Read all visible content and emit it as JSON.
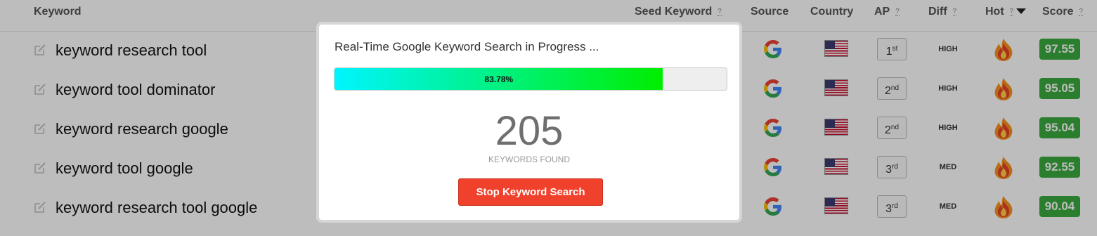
{
  "table": {
    "columns": {
      "keyword": "Keyword",
      "seed_keyword": "Seed Keyword",
      "source": "Source",
      "country": "Country",
      "ap": "AP",
      "diff": "Diff",
      "hot": "Hot",
      "score": "Score",
      "help": "?"
    },
    "rows": [
      {
        "keyword": "keyword research tool",
        "ap_num": "1",
        "ap_suffix": "st",
        "diff": "HIGH",
        "score": "97.55"
      },
      {
        "keyword": "keyword tool dominator",
        "ap_num": "2",
        "ap_suffix": "nd",
        "diff": "HIGH",
        "score": "95.05"
      },
      {
        "keyword": "keyword research google",
        "ap_num": "2",
        "ap_suffix": "nd",
        "diff": "HIGH",
        "score": "95.04"
      },
      {
        "keyword": "keyword tool google",
        "ap_num": "3",
        "ap_suffix": "rd",
        "diff": "MED",
        "score": "92.55"
      },
      {
        "keyword": "keyword research tool google",
        "ap_num": "3",
        "ap_suffix": "rd",
        "diff": "MED",
        "score": "90.04"
      }
    ],
    "source_icon": "google-icon",
    "country_icon": "us-flag-icon",
    "hot_icon": "fire-icon"
  },
  "modal": {
    "title": "Real-Time Google Keyword Search in Progress ...",
    "progress_label": "83.78%",
    "progress_fraction": 0.8378,
    "count": "205",
    "count_label": "KEYWORDS FOUND",
    "stop_button": "Stop Keyword Search"
  },
  "colors": {
    "score_green": "#3aab3f",
    "stop_red": "#f0412c",
    "progress_start": "#00f5ff",
    "progress_end": "#00ee00"
  }
}
